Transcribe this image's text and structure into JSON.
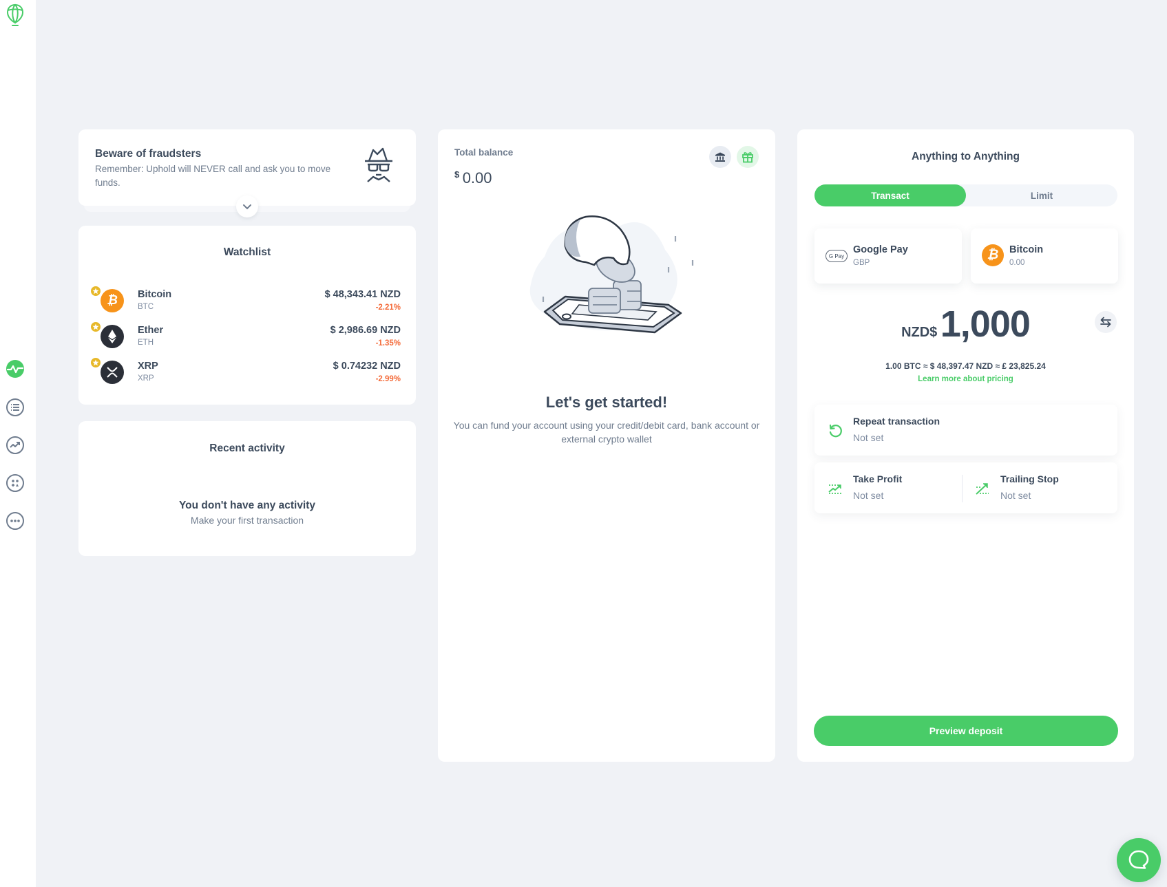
{
  "colors": {
    "brand_green": "#49cc68",
    "negative_change": "#f46b3a",
    "bitcoin_orange": "#f7931a",
    "background": "#f0f2f6"
  },
  "sidebar": {
    "logo_icon": "uphold-logo-icon",
    "items": [
      {
        "name": "activity",
        "icon": "pulse-icon",
        "active": true
      },
      {
        "name": "transactions",
        "icon": "list-icon",
        "active": false
      },
      {
        "name": "markets",
        "icon": "trending-up-icon",
        "active": false
      },
      {
        "name": "products",
        "icon": "apps-icon",
        "active": false
      },
      {
        "name": "more",
        "icon": "more-icon",
        "active": false
      }
    ]
  },
  "fraud_alert": {
    "title": "Beware of fraudsters",
    "text": "Remember: Uphold will NEVER call and ask you to move funds.",
    "icon": "incognito-icon",
    "expand_icon": "chevron-down-icon"
  },
  "watchlist": {
    "title": "Watchlist",
    "items": [
      {
        "name": "Bitcoin",
        "symbol": "BTC",
        "price": "$ 48,343.41 NZD",
        "change": "-2.21%"
      },
      {
        "name": "Ether",
        "symbol": "ETH",
        "price": "$ 2,986.69 NZD",
        "change": "-1.35%"
      },
      {
        "name": "XRP",
        "symbol": "XRP",
        "price": "$ 0.74232 NZD",
        "change": "-2.99%"
      }
    ]
  },
  "recent_activity": {
    "title": "Recent activity",
    "empty_title": "You don't have any activity",
    "empty_subtitle": "Make your first transaction"
  },
  "balance": {
    "label": "Total balance",
    "currency_symbol": "$",
    "value": "0.00",
    "bank_icon": "bank-icon",
    "gift_icon": "gift-icon",
    "heading": "Let's get started!",
    "description": "You can fund your account using your credit/debit card, bank account or external crypto wallet"
  },
  "transact": {
    "title": "Anything to Anything",
    "tabs": [
      {
        "label": "Transact",
        "active": true
      },
      {
        "label": "Limit",
        "active": false
      }
    ],
    "from": {
      "name": "Google Pay",
      "sub": "GBP",
      "badge": "G Pay"
    },
    "to": {
      "name": "Bitcoin",
      "sub": "0.00",
      "badge": "₿"
    },
    "amount_currency": "NZD$",
    "amount_value": "1,000",
    "rate": "1.00 BTC ≈ $ 48,397.47 NZD ≈ £ 23,825.24",
    "pricing_link": "Learn more about pricing",
    "repeat": {
      "title": "Repeat transaction",
      "value": "Not set"
    },
    "take_profit": {
      "title": "Take Profit",
      "value": "Not set"
    },
    "trailing_stop": {
      "title": "Trailing Stop",
      "value": "Not set"
    },
    "preview_button": "Preview deposit"
  },
  "chat": {
    "icon": "chat-bubble-icon"
  }
}
